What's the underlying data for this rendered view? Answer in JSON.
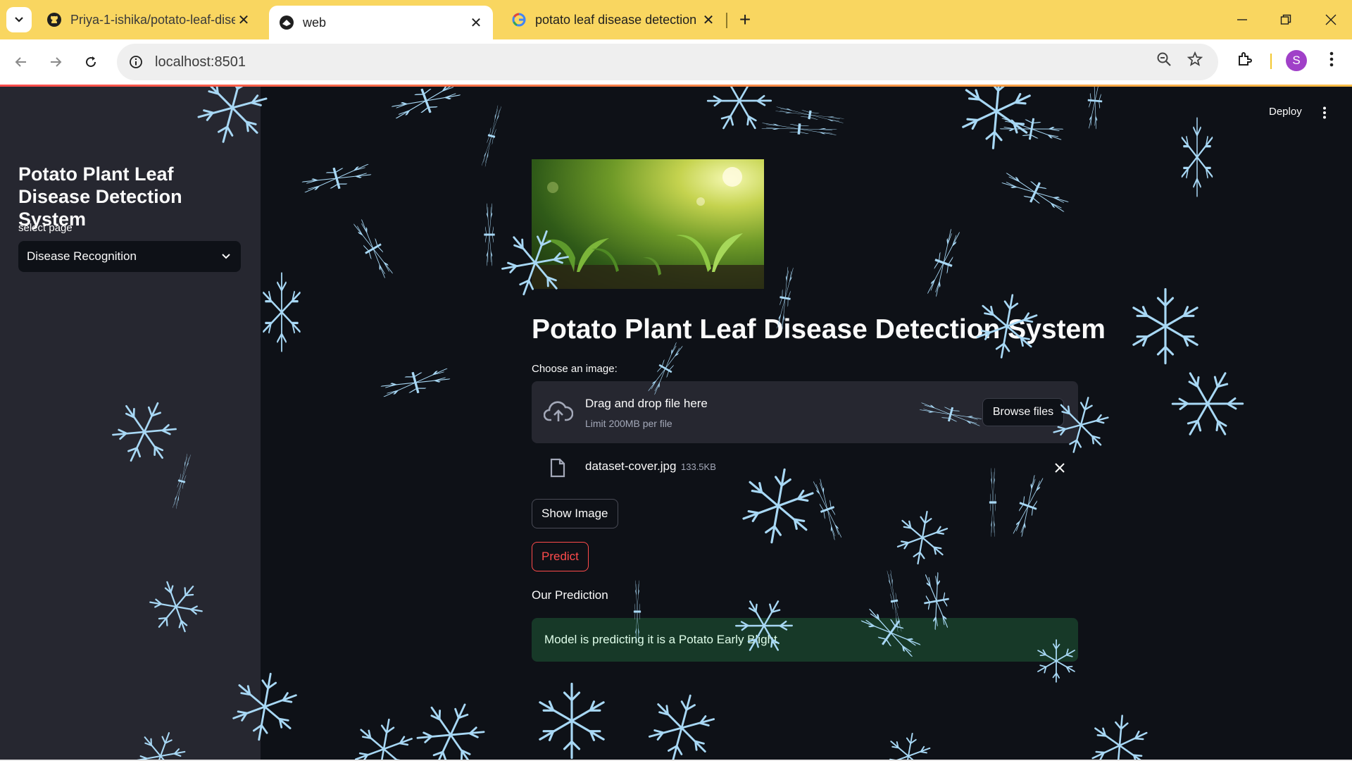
{
  "browser": {
    "tabs": [
      {
        "title": "Priya-1-ishika/potato-leaf-disea",
        "icon": "github-icon",
        "active": false
      },
      {
        "title": "web",
        "icon": "streamlit-icon",
        "active": true
      },
      {
        "title": "potato leaf disease detection - ",
        "icon": "google-icon",
        "active": false
      }
    ],
    "address": "localhost:8501",
    "profile_initial": "S",
    "colors": {
      "tabbar": "#f9d660",
      "profile": "#a040c8"
    }
  },
  "app": {
    "header": {
      "deploy_label": "Deploy"
    },
    "sidebar": {
      "title": "Potato Plant Leaf Disease Detection System",
      "select_label": "select page",
      "selected_page": "Disease Recognition"
    },
    "main": {
      "title": "Potato Plant Leaf Disease Detection System",
      "uploader": {
        "label": "Choose an image:",
        "drop_text": "Drag and drop file here",
        "limit_text": "Limit 200MB per file",
        "browse_label": "Browse files"
      },
      "file": {
        "name": "dataset-cover.jpg",
        "size": "133.5KB"
      },
      "show_image_label": "Show Image",
      "predict_label": "Predict",
      "prediction_heading": "Our Prediction",
      "prediction_text": "Model is predicting it is a Potato Early Blight"
    },
    "colors": {
      "background": "#0e1117",
      "sidebar": "#262730",
      "accent": "#ff4b4b",
      "success_bg": "#173928"
    }
  }
}
